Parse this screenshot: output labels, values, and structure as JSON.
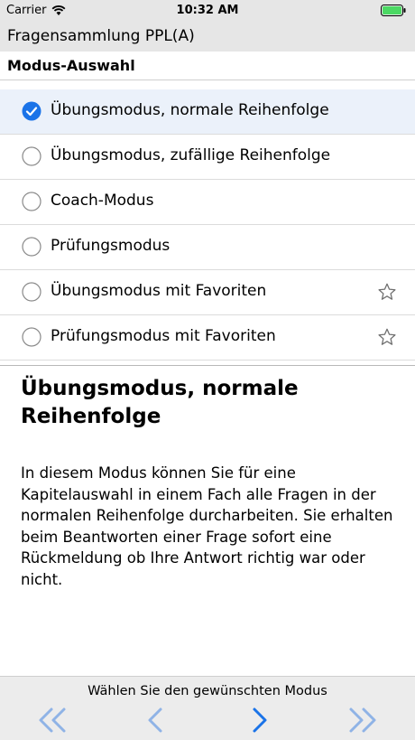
{
  "status_bar": {
    "carrier": "Carrier",
    "time": "10:32 AM"
  },
  "nav": {
    "title": "Fragensammlung PPL(A)"
  },
  "section": {
    "title": "Modus-Auswahl"
  },
  "modes": [
    {
      "label": "Übungsmodus, normale Reihenfolge",
      "selected": true,
      "favorite_icon": false
    },
    {
      "label": "Übungsmodus, zufällige Reihenfolge",
      "selected": false,
      "favorite_icon": false
    },
    {
      "label": "Coach-Modus",
      "selected": false,
      "favorite_icon": false
    },
    {
      "label": "Prüfungsmodus",
      "selected": false,
      "favorite_icon": false
    },
    {
      "label": "Übungsmodus mit Favoriten",
      "selected": false,
      "favorite_icon": true
    },
    {
      "label": "Prüfungsmodus mit Favoriten",
      "selected": false,
      "favorite_icon": true
    }
  ],
  "description": {
    "title": "Übungsmodus, normale Reihenfolge",
    "body": "In diesem Modus können Sie für eine Kapitelauswahl in einem Fach alle Fragen in der normalen Reihenfolge durcharbeiten. Sie erhalten beim Beantworten einer Frage sofort eine Rückmeldung ob Ihre Antwort richtig war oder nicht."
  },
  "toolbar": {
    "hint": "Wählen Sie den gewünschten Modus"
  },
  "colors": {
    "accent": "#1a73e8",
    "accent_light": "#8fb3e6",
    "selected_row": "#ebf1fa",
    "bar_bg": "#e6e6e6",
    "battery": "#4cd964"
  }
}
